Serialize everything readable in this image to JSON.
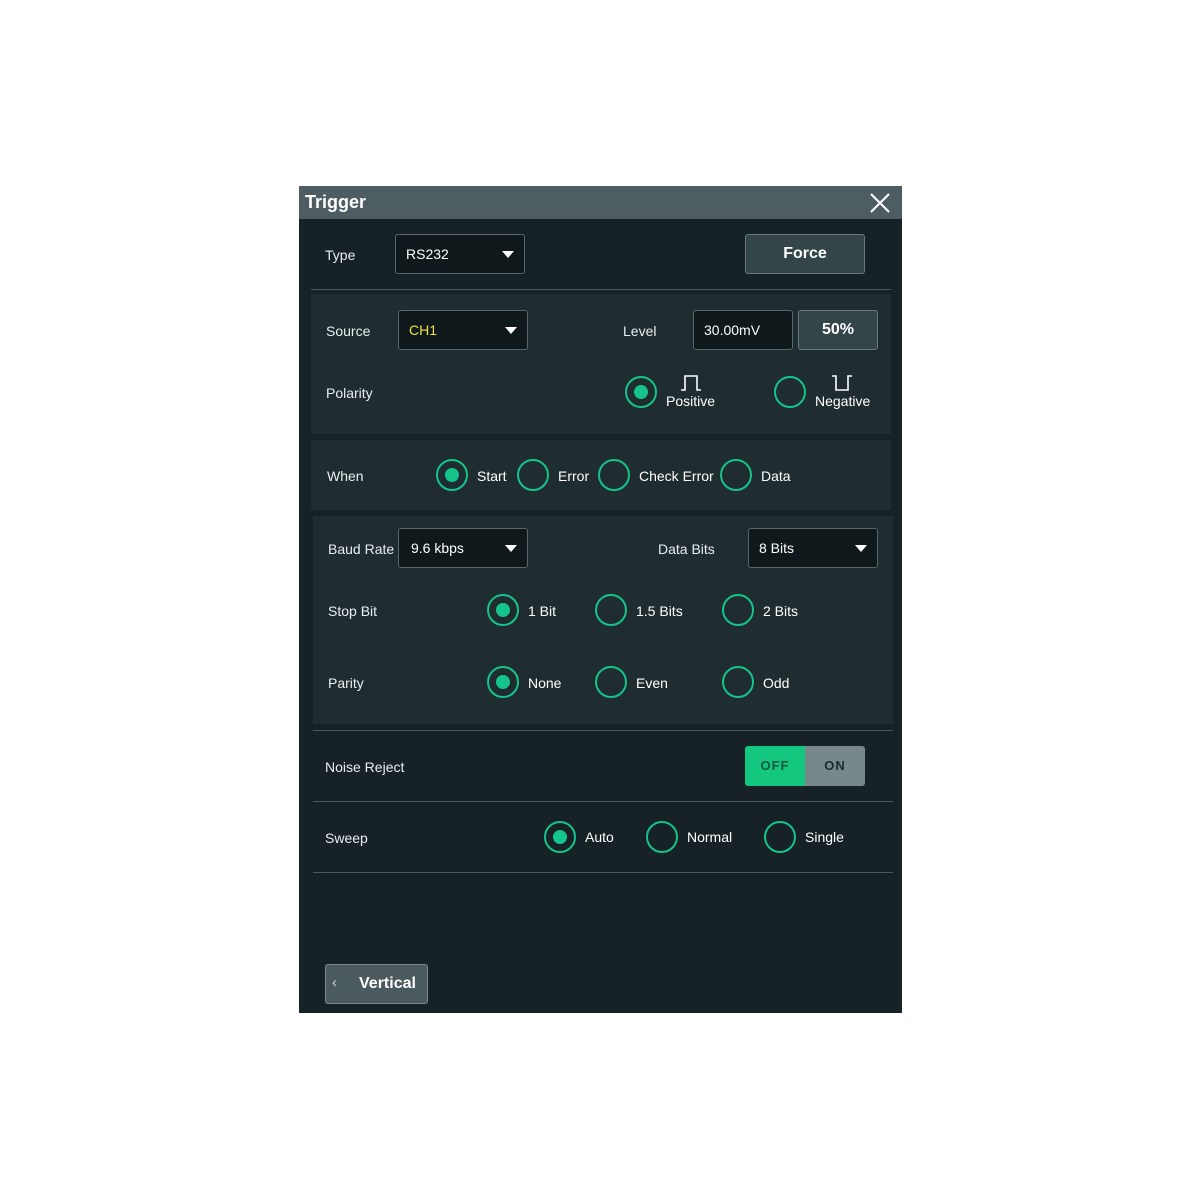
{
  "window": {
    "title": "Trigger",
    "close_icon": "close-icon"
  },
  "type_row": {
    "label": "Type",
    "selected": "RS232",
    "force_label": "Force"
  },
  "source_row": {
    "label": "Source",
    "selected": "CH1",
    "selected_color": "#f0e040",
    "level_label": "Level",
    "level_value": "30.00mV",
    "fifty_label": "50%"
  },
  "polarity": {
    "label": "Polarity",
    "options": [
      {
        "label": "Positive",
        "icon": "positive-pulse-icon",
        "checked": true
      },
      {
        "label": "Negative",
        "icon": "negative-pulse-icon",
        "checked": false
      }
    ]
  },
  "when": {
    "label": "When",
    "options": [
      "Start",
      "Error",
      "Check Error",
      "Data"
    ],
    "selected": "Start"
  },
  "baud": {
    "label": "Baud Rate",
    "selected": "9.6  kbps"
  },
  "data_bits": {
    "label": "Data Bits",
    "selected": "8 Bits"
  },
  "stop_bit": {
    "label": "Stop Bit",
    "options": [
      "1 Bit",
      "1.5 Bits",
      "2 Bits"
    ],
    "selected": "1 Bit"
  },
  "parity": {
    "label": "Parity",
    "options": [
      "None",
      "Even",
      "Odd"
    ],
    "selected": "None"
  },
  "noise_reject": {
    "label": "Noise Reject",
    "off_label": "OFF",
    "on_label": "ON",
    "state": "OFF"
  },
  "sweep": {
    "label": "Sweep",
    "options": [
      "Auto",
      "Normal",
      "Single"
    ],
    "selected": "Auto"
  },
  "nav": {
    "back_label": "Vertical"
  },
  "colors": {
    "accent": "#15c48a",
    "panel": "#162226",
    "section": "#1f2d31",
    "titlebar": "#4d5d61"
  }
}
